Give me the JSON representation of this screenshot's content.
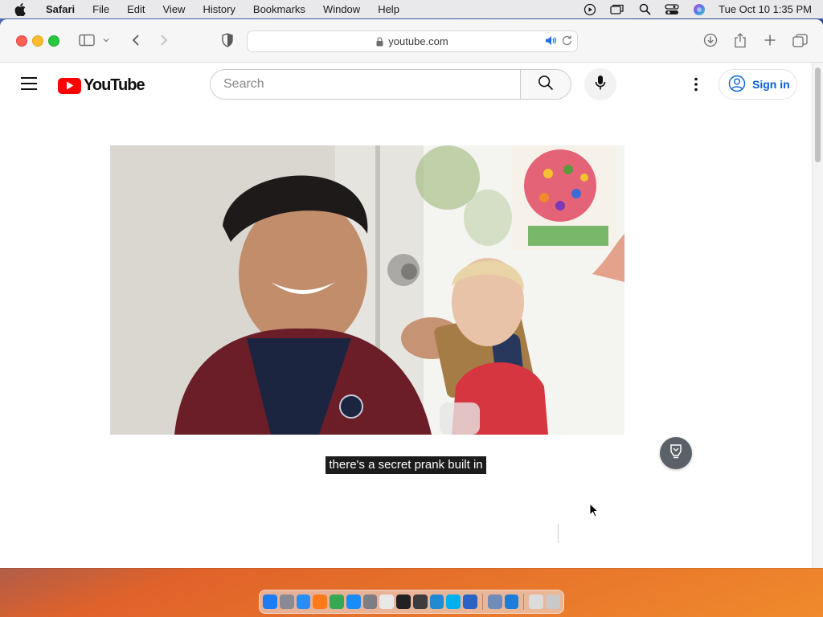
{
  "menubar": {
    "app_name": "Safari",
    "items": [
      "File",
      "Edit",
      "View",
      "History",
      "Bookmarks",
      "Window",
      "Help"
    ],
    "clock": "Tue Oct 10  1:35 PM",
    "status_icons": [
      "play-circle-icon",
      "screen-mirror-icon",
      "spotlight-search-icon",
      "control-center-icon",
      "siri-icon"
    ]
  },
  "browser": {
    "url": "youtube.com",
    "toolbar_icons": [
      "sidebar-icon",
      "chevron-down-icon",
      "back-icon",
      "forward-icon",
      "privacy-shield-icon",
      "download-icon",
      "share-icon",
      "new-tab-icon",
      "tab-overview-icon"
    ]
  },
  "youtube": {
    "logo_text": "YouTube",
    "search_placeholder": "Search",
    "signin_label": "Sign in",
    "caption": "there's a secret prank built in"
  },
  "dock": {
    "apps": [
      {
        "name": "finder",
        "color": "#1e7cf2"
      },
      {
        "name": "launchpad",
        "color": "#8a8a95"
      },
      {
        "name": "safari",
        "color": "#2a8cf5"
      },
      {
        "name": "firefox",
        "color": "#ff7a1a"
      },
      {
        "name": "chrome",
        "color": "#34a853"
      },
      {
        "name": "app-store",
        "color": "#1a8cf7"
      },
      {
        "name": "system-settings",
        "color": "#7d7d85"
      },
      {
        "name": "text-edit",
        "color": "#e8e8e8"
      },
      {
        "name": "terminal",
        "color": "#222222"
      },
      {
        "name": "xcode-tools",
        "color": "#3d3d3d"
      },
      {
        "name": "vs-code",
        "color": "#1f8ad2"
      },
      {
        "name": "skype",
        "color": "#00aff0"
      },
      {
        "name": "migration",
        "color": "#2b62c4"
      },
      {
        "name": "preview",
        "color": "#6e8cb5"
      },
      {
        "name": "xcode",
        "color": "#1c7cd6"
      },
      {
        "name": "downloads-folder",
        "color": "#dcdcdc"
      },
      {
        "name": "trash",
        "color": "#c9c9c9"
      }
    ]
  }
}
